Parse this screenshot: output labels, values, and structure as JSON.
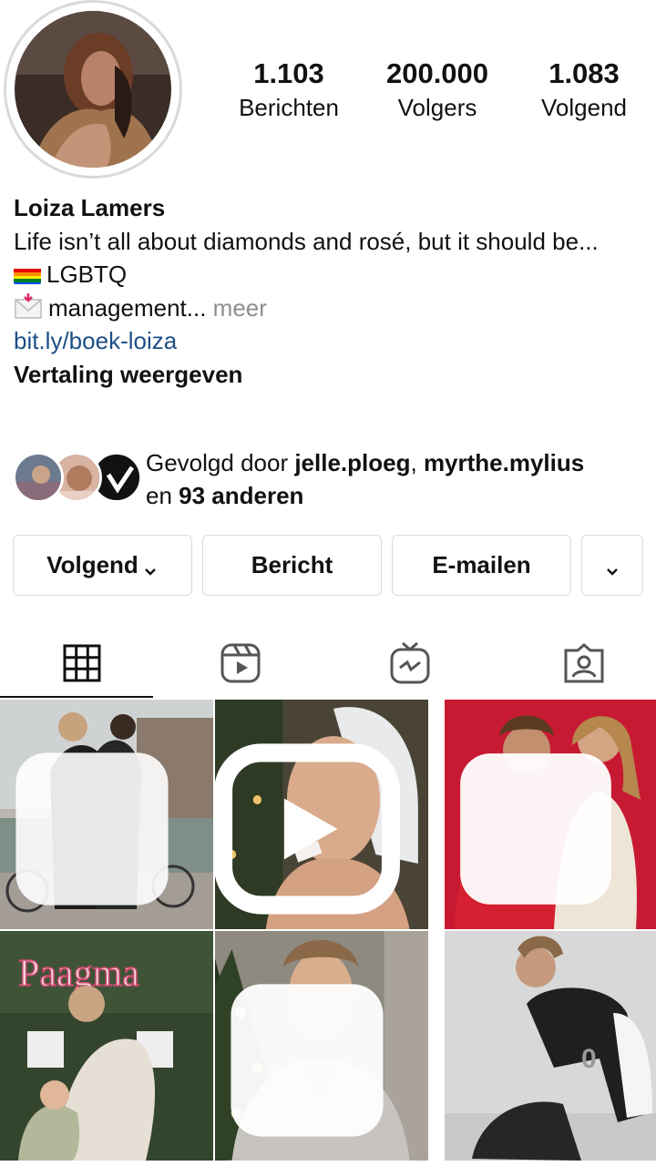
{
  "profile": {
    "name": "Loiza Lamers",
    "stats": [
      {
        "value": "1.103",
        "label": "Berichten"
      },
      {
        "value": "200.000",
        "label": "Volgers"
      },
      {
        "value": "1.083",
        "label": "Volgend"
      }
    ],
    "bio_line1": "Life isn’t all about diamonds and rosé, but it should be...",
    "bio_lgbtq": "LGBTQ",
    "bio_management": "management...",
    "bio_more": "meer",
    "link": "bit.ly/boek-loiza",
    "translate": "Vertaling weergeven"
  },
  "followed_by": {
    "prefix": "Gevolgd door ",
    "user1": "jelle.ploeg",
    "separator": ", ",
    "user2": "myrthe.mylius",
    "middle": "en ",
    "others": "93 anderen"
  },
  "buttons": {
    "follow": "Volgend",
    "message": "Bericht",
    "email": "E-mailen"
  },
  "tabs": [
    "grid-icon",
    "reels-icon",
    "igtv-icon",
    "tagged-icon"
  ],
  "colors": {
    "link": "#1d4f86",
    "muted": "#8e8e8e",
    "border": "#dbdbdb"
  }
}
